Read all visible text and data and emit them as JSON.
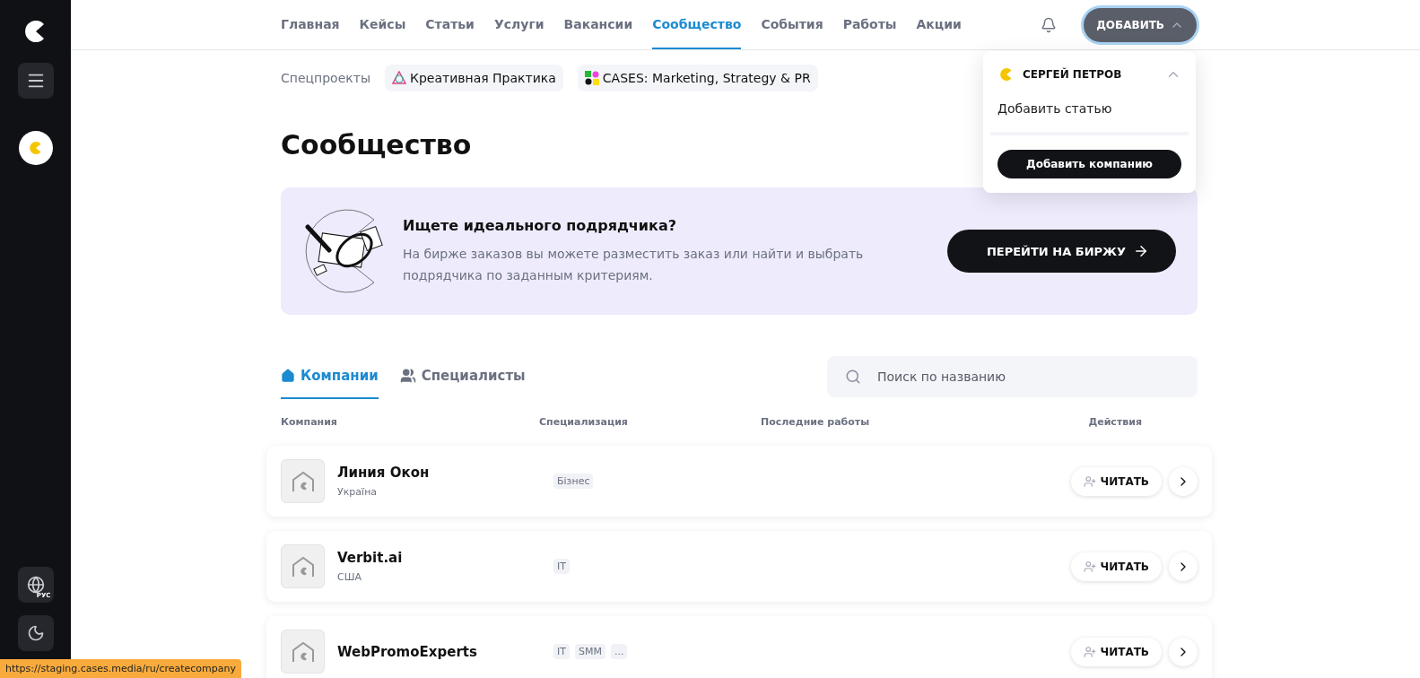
{
  "nav": {
    "items": [
      {
        "label": "Главная",
        "selected": false
      },
      {
        "label": "Кейсы",
        "selected": false
      },
      {
        "label": "Статьи",
        "selected": false
      },
      {
        "label": "Услуги",
        "selected": false
      },
      {
        "label": "Вакансии",
        "selected": false
      },
      {
        "label": "Сообщество",
        "selected": true
      },
      {
        "label": "События",
        "selected": false
      },
      {
        "label": "Работы",
        "selected": false
      },
      {
        "label": "Акции",
        "selected": false
      }
    ],
    "add_button": "ДОБАВИТЬ",
    "add_expanded": true
  },
  "sidebar": {
    "language": "РУС"
  },
  "specprojects": {
    "label": "Спецпроекты",
    "items": [
      "Креативная Практика",
      "CASES: Marketing, Strategy & PR"
    ]
  },
  "title": "Сообщество",
  "promo": {
    "heading": "Ищете идеального подрядчика?",
    "text": "На бирже заказов вы можете разместить заказ или найти и выбрать подрядчика по заданным критериям.",
    "button": "ПЕРЕЙТИ НА БИРЖУ"
  },
  "tabs": [
    {
      "label": "Компании",
      "selected": true,
      "kind": "company"
    },
    {
      "label": "Специалисты",
      "selected": false,
      "kind": "people"
    }
  ],
  "search": {
    "placeholder": "Поиск по названию"
  },
  "table": {
    "columns": [
      "Компания",
      "Специализация",
      "Последние работы",
      "Действия"
    ],
    "rows": [
      {
        "name": "Линия Окон",
        "country": "Україна",
        "tags": [
          "Бізнес"
        ],
        "action": "ЧИТАТЬ"
      },
      {
        "name": "Verbit.ai",
        "country": "США",
        "tags": [
          "IT"
        ],
        "action": "ЧИТАТЬ"
      },
      {
        "name": "WebPromoExperts",
        "tags": [
          "IT",
          "SMM",
          "..."
        ],
        "action": "ЧИТАТЬ"
      }
    ]
  },
  "dropdown": {
    "user": "СЕРГЕЙ ПЕТРОВ",
    "items": [
      "Добавить статью"
    ],
    "button": "Добавить компанию"
  },
  "status_url": "https://staging.cases.media/ru/createcompany"
}
